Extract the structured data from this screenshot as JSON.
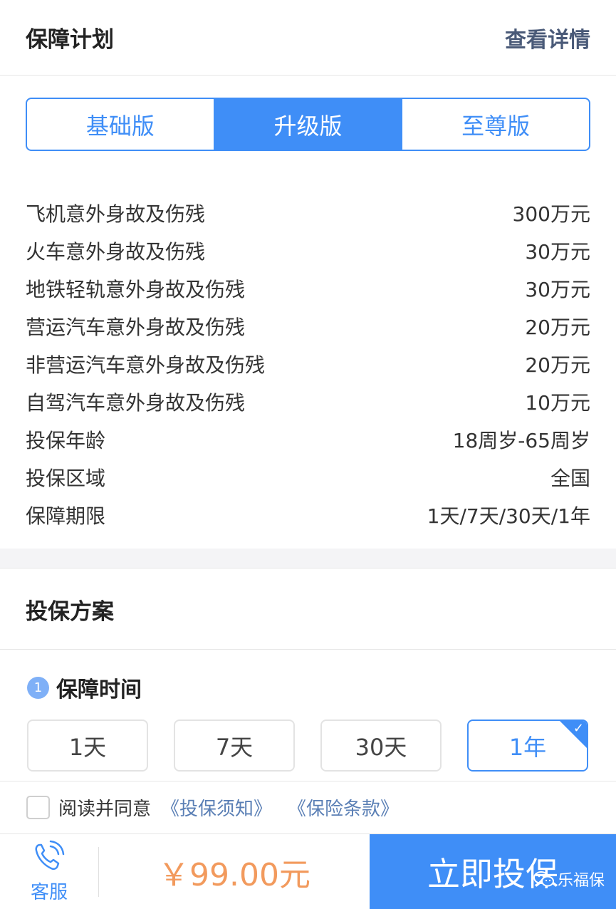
{
  "plan_section": {
    "title": "保障计划",
    "detail_link": "查看详情",
    "tabs": [
      {
        "label": "基础版",
        "active": false
      },
      {
        "label": "升级版",
        "active": true
      },
      {
        "label": "至尊版",
        "active": false
      }
    ],
    "rows": [
      {
        "label": "飞机意外身故及伤残",
        "value": "300万元"
      },
      {
        "label": "火车意外身故及伤残",
        "value": "30万元"
      },
      {
        "label": "地铁轻轨意外身故及伤残",
        "value": "30万元"
      },
      {
        "label": "营运汽车意外身故及伤残",
        "value": "20万元"
      },
      {
        "label": "非营运汽车意外身故及伤残",
        "value": "20万元"
      },
      {
        "label": "自驾汽车意外身故及伤残",
        "value": "10万元"
      },
      {
        "label": "投保年龄",
        "value": "18周岁-65周岁"
      },
      {
        "label": "投保区域",
        "value": "全国"
      },
      {
        "label": "保障期限",
        "value": "1天/7天/30天/1年"
      }
    ]
  },
  "scheme_section": {
    "title": "投保方案",
    "step": {
      "number": "1",
      "label": "保障时间"
    },
    "durations": [
      {
        "label": "1天",
        "selected": false
      },
      {
        "label": "7天",
        "selected": false
      },
      {
        "label": "30天",
        "selected": false
      },
      {
        "label": "1年",
        "selected": true
      }
    ]
  },
  "agreement": {
    "text": "阅读并同意",
    "link_notice": "《投保须知》",
    "link_terms": "《保险条款》"
  },
  "bottom_bar": {
    "service_label": "客服",
    "price": "￥99.00元",
    "buy_label": "立即投保",
    "watermark": "乐福保"
  },
  "colors": {
    "accent": "#3f8ef7",
    "price": "#f29a5d",
    "link": "#5a7fb5"
  },
  "icons": {
    "service": "phone-icon",
    "check": "check-icon",
    "watermark": "wechat-icon"
  }
}
